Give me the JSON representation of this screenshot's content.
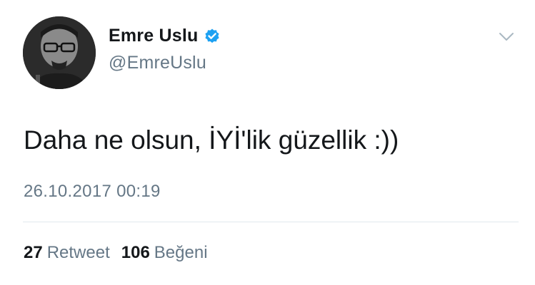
{
  "tweet": {
    "author": {
      "display_name": "Emre Uslu",
      "handle": "@EmreUslu",
      "verified_icon": "verified-badge-icon",
      "avatar_icon": "avatar"
    },
    "text": "Daha ne olsun, İYİ'lik güzellik :))",
    "timestamp": "26.10.2017 00:19",
    "stats": [
      {
        "count": "27",
        "label": "Retweet"
      },
      {
        "count": "106",
        "label": "Beğeni"
      }
    ],
    "menu_icon": "chevron-down-icon"
  },
  "colors": {
    "text_primary": "#14171a",
    "text_secondary": "#657786",
    "verified_blue": "#1da1f2",
    "divider": "#e1e8ed"
  }
}
